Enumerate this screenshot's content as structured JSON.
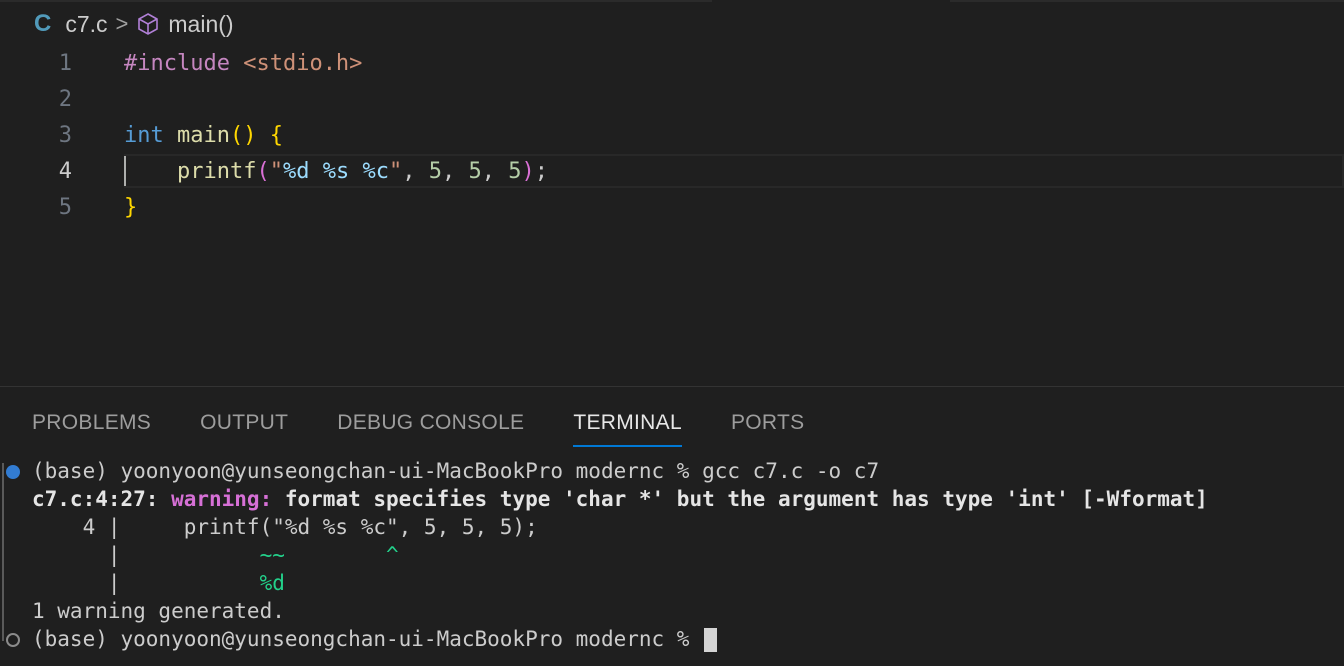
{
  "breadcrumb": {
    "file_icon": "C",
    "file": "c7.c",
    "separator": ">",
    "symbol": "main()"
  },
  "editor": {
    "line_numbers": [
      "1",
      "2",
      "3",
      "4",
      "5"
    ],
    "current_line": 4,
    "line1": {
      "pre": "#include",
      "inc": "<stdio.h>"
    },
    "line3": {
      "kw": "int",
      "fn": "main",
      "paren": "()",
      "brace": "{"
    },
    "line4": {
      "fn": "printf",
      "open": "(",
      "q1": "\"",
      "e1": "%d",
      "e2": "%s",
      "e3": "%c",
      "q2": "\"",
      "args": ", ",
      "n1": "5",
      "n2": "5",
      "n3": "5",
      "close": ")",
      "semi": ";"
    },
    "line5": {
      "brace": "}"
    }
  },
  "panel": {
    "tabs": [
      "PROBLEMS",
      "OUTPUT",
      "DEBUG CONSOLE",
      "TERMINAL",
      "PORTS"
    ],
    "active_tab": "TERMINAL"
  },
  "terminal": {
    "prompt1": "(base) yoonyoon@yunseongchan-ui-MacBookPro modernc % gcc c7.c -o c7",
    "warn_loc": "c7.c:4:27: ",
    "warn_label": "warning: ",
    "warn_msg": "format specifies type 'char *' but the argument has type 'int' [-Wformat]",
    "src_line": "    4 |     printf(\"%d %s %c\", 5, 5, 5);",
    "marker_bar": "      |",
    "marker_tilde": "~~",
    "marker_caret": "^",
    "fix_bar": "      |",
    "fix_text": "%d",
    "summary": "1 warning generated.",
    "prompt2": "(base) yoonyoon@yunseongchan-ui-MacBookPro modernc % "
  }
}
